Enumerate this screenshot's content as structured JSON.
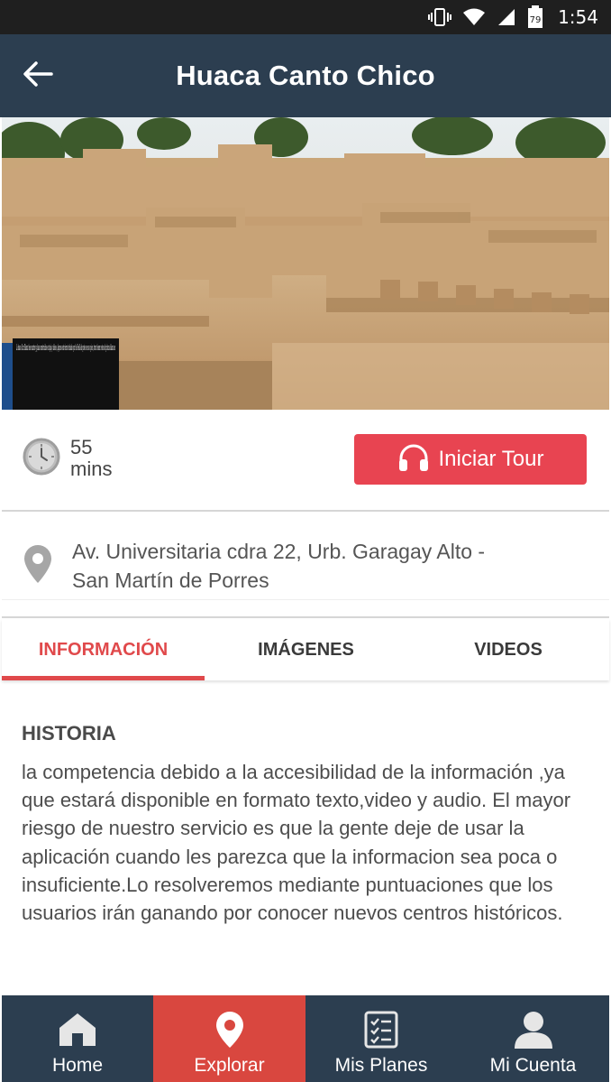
{
  "status_bar": {
    "time": "1:54",
    "battery_level": "79",
    "icons": [
      "vibrate-icon",
      "wifi-icon",
      "signal-icon",
      "battery-icon"
    ]
  },
  "app_bar": {
    "title": "Huaca Canto Chico",
    "back_icon": "arrow-left-icon"
  },
  "hero": {
    "sign_text": "La huaca Cruz Blanca tiene cuartos y plazas construidos en tapia y adobes, algunos estuvieron techados por las Huella de postes en sus pisos, otros tienen restos de pintura blanca en"
  },
  "duration": {
    "value": "55",
    "unit": "mins",
    "icon": "clock-icon"
  },
  "tour_button": {
    "label": "Iniciar Tour",
    "icon": "headphones-icon"
  },
  "address": {
    "line1": "Av. Universitaria cdra 22, Urb. Garagay Alto -",
    "line2": "San Martín de Porres",
    "icon": "location-pin-icon"
  },
  "tabs": [
    {
      "label": "INFORMACIÓN",
      "active": true
    },
    {
      "label": "IMÁGENES",
      "active": false
    },
    {
      "label": "VIDEOS",
      "active": false
    }
  ],
  "content": {
    "heading": "HISTORIA",
    "body": "la competencia debido a la accesibilidad de la información ,ya que estará disponible en formato texto,video y audio. El mayor riesgo de nuestro servicio es que la gente deje de usar la aplicación cuando les parezca que la informacion sea poca o insuficiente.Lo resolveremos mediante puntuaciones que los usuarios irán ganando por conocer nuevos centros históricos."
  },
  "bottom_nav": [
    {
      "label": "Home",
      "icon": "home-icon",
      "active": false
    },
    {
      "label": "Explorar",
      "icon": "location-pin-icon",
      "active": true
    },
    {
      "label": "Mis Planes",
      "icon": "checklist-icon",
      "active": false
    },
    {
      "label": "Mi Cuenta",
      "icon": "user-icon",
      "active": false
    }
  ],
  "colors": {
    "status_bar": "#1f1f1f",
    "app_bar": "#2c3e50",
    "accent": "#e0494b",
    "tour_button": "#e84451",
    "bottom_nav": "#2c3e50",
    "bottom_nav_active": "#d9473f"
  }
}
